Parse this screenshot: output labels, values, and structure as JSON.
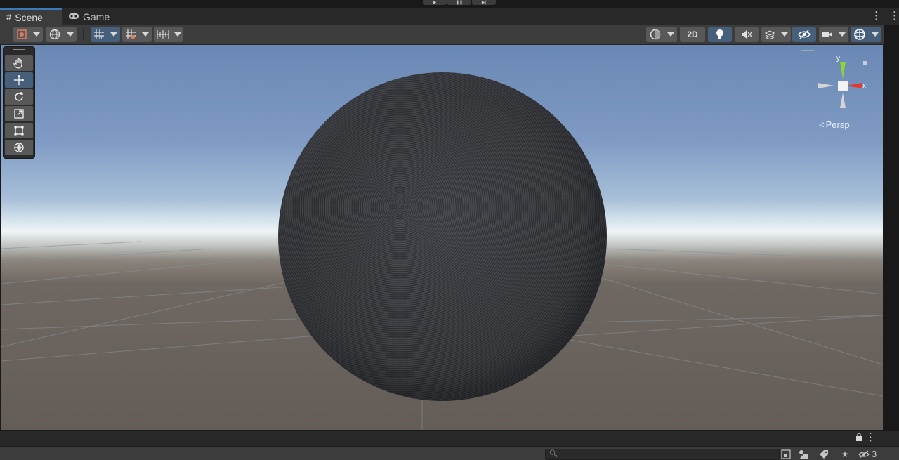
{
  "tabs": [
    {
      "label": "Scene",
      "glyph": "#",
      "active": true
    },
    {
      "label": "Game",
      "glyph": "game-controller",
      "active": false
    }
  ],
  "toolbar": {
    "mode_2d": "2D"
  },
  "scene": {
    "camera_mode": "Persp",
    "gizmo_axes": {
      "y": "y",
      "x": "x"
    }
  },
  "footer": {
    "search_placeholder": "",
    "hidden_count": "3"
  },
  "colors": {
    "active_blue": "#46607c",
    "accent_tab": "#3a79bb",
    "axis_y": "#8cd63a",
    "axis_x": "#e03b32"
  },
  "icons": {
    "tools": [
      "hand-icon",
      "move-icon",
      "rotate-icon",
      "scale-icon",
      "rect-icon",
      "transform-icon"
    ]
  }
}
